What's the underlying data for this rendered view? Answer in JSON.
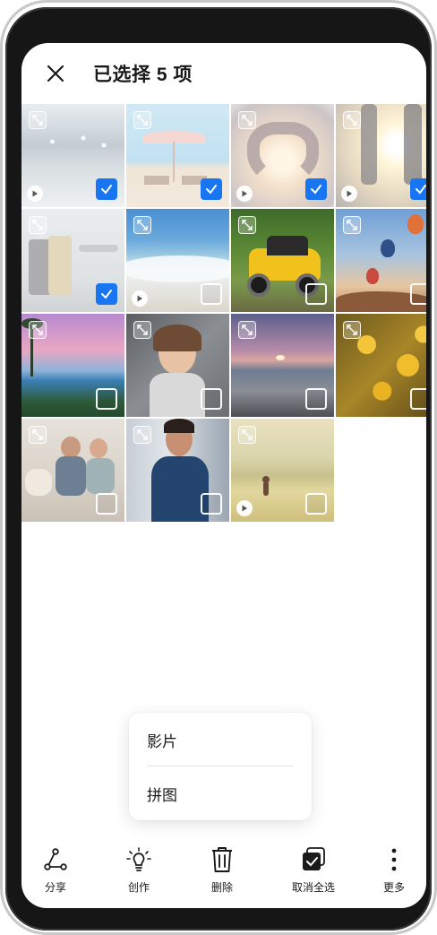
{
  "header": {
    "title": "已选择 5 项"
  },
  "photos": [
    {
      "selected": true,
      "video": true
    },
    {
      "selected": true,
      "video": false
    },
    {
      "selected": true,
      "video": true
    },
    {
      "selected": true,
      "video": true
    },
    {
      "selected": true,
      "video": false
    },
    {
      "selected": false,
      "video": true
    },
    {
      "selected": false,
      "video": false
    },
    {
      "selected": false,
      "video": false
    },
    {
      "selected": false,
      "video": false
    },
    {
      "selected": false,
      "video": false
    },
    {
      "selected": false,
      "video": false
    },
    {
      "selected": false,
      "video": false
    },
    {
      "selected": false,
      "video": false
    },
    {
      "selected": false,
      "video": false
    },
    {
      "selected": false,
      "video": true
    }
  ],
  "menu": {
    "items": [
      "影片",
      "拼图"
    ]
  },
  "toolbar": {
    "share_label": "分享",
    "create_label": "创作",
    "delete_label": "删除",
    "deselect_all_label": "取消全选",
    "more_label": "更多"
  },
  "colors": {
    "accent": "#1976f2"
  }
}
